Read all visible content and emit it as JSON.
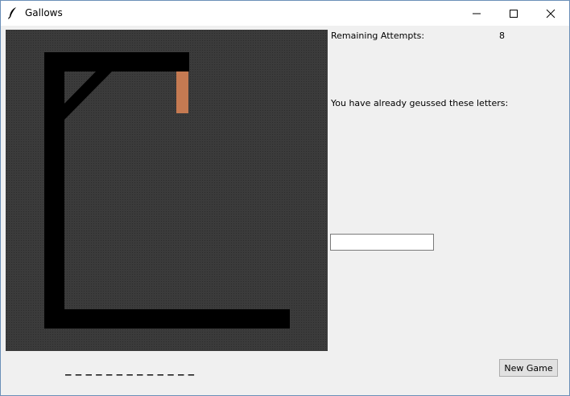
{
  "window": {
    "title": "Gallows",
    "app_icon": "feather-icon",
    "controls": [
      "minimize-icon",
      "maximize-icon",
      "close-icon"
    ]
  },
  "canvas": {
    "background": "#3b3b3b",
    "gallows_color": "#000000",
    "rope_color": "#c57a52"
  },
  "info": {
    "remaining_label": "Remaining Attempts:",
    "remaining_value": "8",
    "guessed_label": "You have already geussed these letters:",
    "guessed_letters": ""
  },
  "guess_input": {
    "value": "",
    "placeholder": ""
  },
  "word": {
    "display": "_ _ _ _ _ _ _ _ _ _ _ _ _"
  },
  "buttons": {
    "new_game": "New Game"
  }
}
